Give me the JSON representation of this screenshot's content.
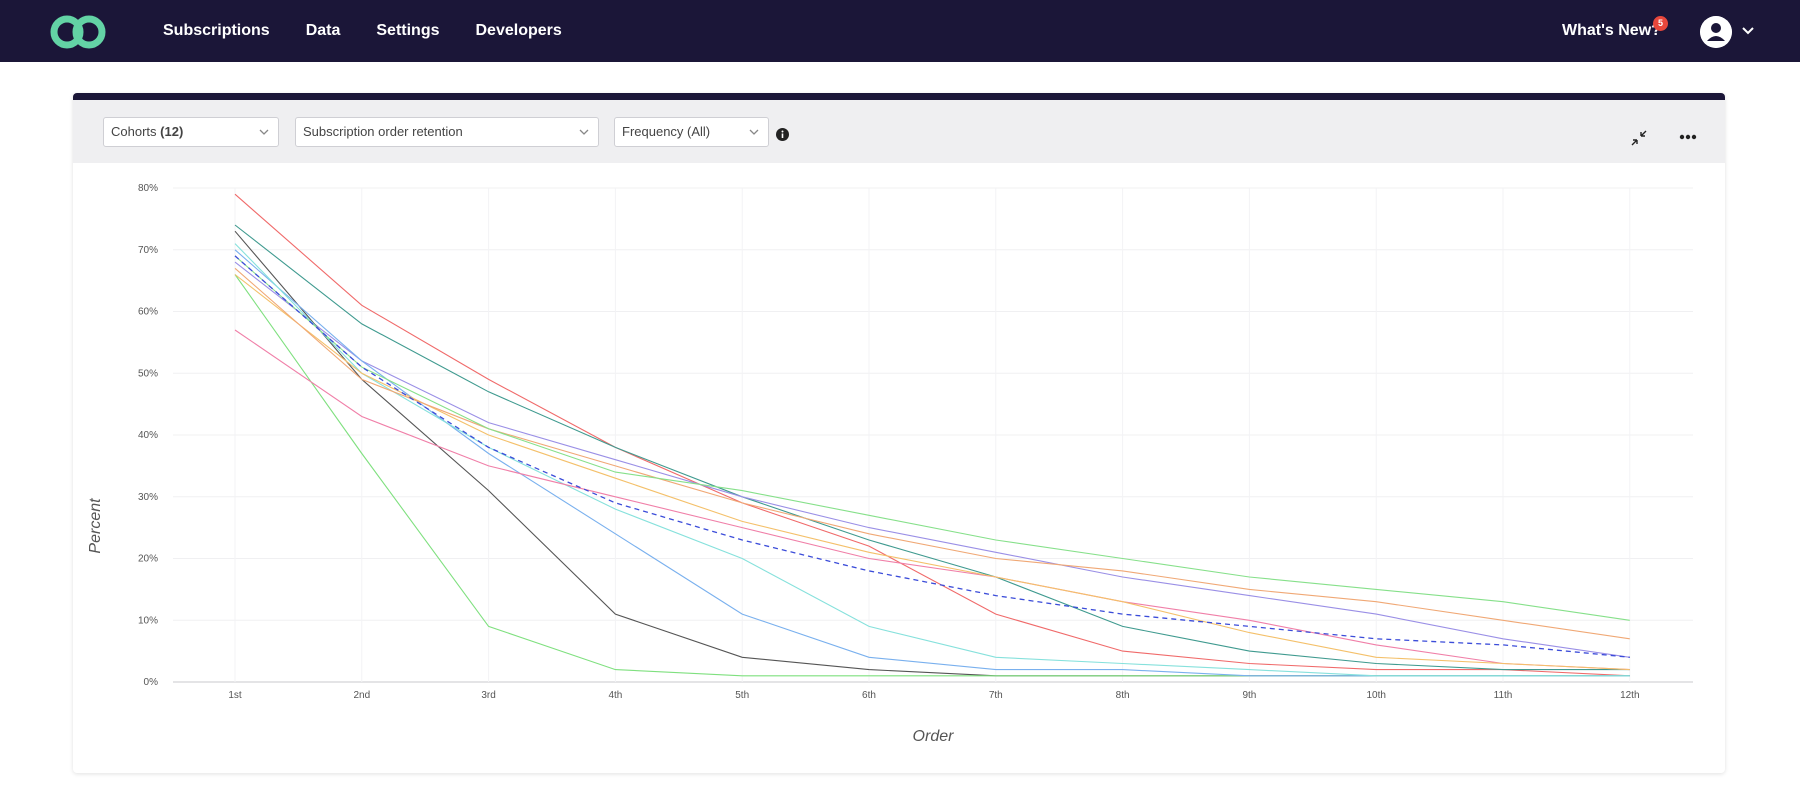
{
  "nav": {
    "items": [
      "Subscriptions",
      "Data",
      "Settings",
      "Developers"
    ],
    "whats_new": "What's New?",
    "badge_count": "5"
  },
  "toolbar": {
    "cohorts_label": "Cohorts",
    "cohorts_count": "(12)",
    "metric": "Subscription order retention",
    "frequency": "Frequency (All)"
  },
  "chart_data": {
    "type": "line",
    "xlabel": "Order",
    "ylabel": "Percent",
    "x": [
      "1st",
      "2nd",
      "3rd",
      "4th",
      "5th",
      "6th",
      "7th",
      "8th",
      "9th",
      "10th",
      "11th",
      "12th"
    ],
    "y_ticks": [
      "0%",
      "10%",
      "20%",
      "30%",
      "40%",
      "50%",
      "60%",
      "70%",
      "80%"
    ],
    "ylim": [
      0,
      80
    ],
    "grid": true,
    "series": [
      {
        "color": "#f06a6a",
        "dashed": false,
        "values": [
          79,
          61,
          49,
          38,
          29,
          22,
          11,
          5,
          3,
          2,
          2,
          1
        ]
      },
      {
        "color": "#3f9a8f",
        "dashed": false,
        "values": [
          74,
          58,
          47,
          38,
          30,
          23,
          17,
          9,
          5,
          3,
          2,
          2
        ]
      },
      {
        "color": "#9a8fe6",
        "dashed": false,
        "values": [
          68,
          52,
          42,
          36,
          30,
          25,
          21,
          17,
          14,
          11,
          7,
          4
        ]
      },
      {
        "color": "#555555",
        "dashed": false,
        "values": [
          73,
          49,
          31,
          11,
          4,
          2,
          1,
          1,
          1,
          1,
          1,
          1
        ]
      },
      {
        "color": "#7fe07f",
        "dashed": false,
        "values": [
          66,
          37,
          9,
          2,
          1,
          1,
          1,
          1,
          1,
          1,
          1,
          1
        ]
      },
      {
        "color": "#79b0ee",
        "dashed": false,
        "values": [
          70,
          52,
          37,
          24,
          11,
          4,
          2,
          2,
          1,
          1,
          1,
          1
        ]
      },
      {
        "color": "#86e1dc",
        "dashed": false,
        "values": [
          71,
          50,
          38,
          28,
          20,
          9,
          4,
          3,
          2,
          1,
          1,
          1
        ]
      },
      {
        "color": "#f07fa8",
        "dashed": false,
        "values": [
          57,
          43,
          35,
          30,
          25,
          20,
          17,
          13,
          10,
          6,
          3,
          2
        ]
      },
      {
        "color": "#f4c06a",
        "dashed": false,
        "values": [
          66,
          50,
          40,
          33,
          26,
          21,
          17,
          13,
          8,
          4,
          3,
          2
        ]
      },
      {
        "color": "#f0a875",
        "dashed": false,
        "values": [
          67,
          49,
          41,
          35,
          29,
          24,
          20,
          18,
          15,
          13,
          10,
          7
        ]
      },
      {
        "color": "#86e08a",
        "dashed": false,
        "values": [
          69,
          51,
          41,
          34,
          31,
          27,
          23,
          20,
          17,
          15,
          13,
          10
        ]
      },
      {
        "color": "#3b4cd9",
        "dashed": true,
        "values": [
          69,
          51,
          38,
          29,
          23,
          18,
          14,
          11,
          9,
          7,
          6,
          4
        ]
      }
    ]
  }
}
